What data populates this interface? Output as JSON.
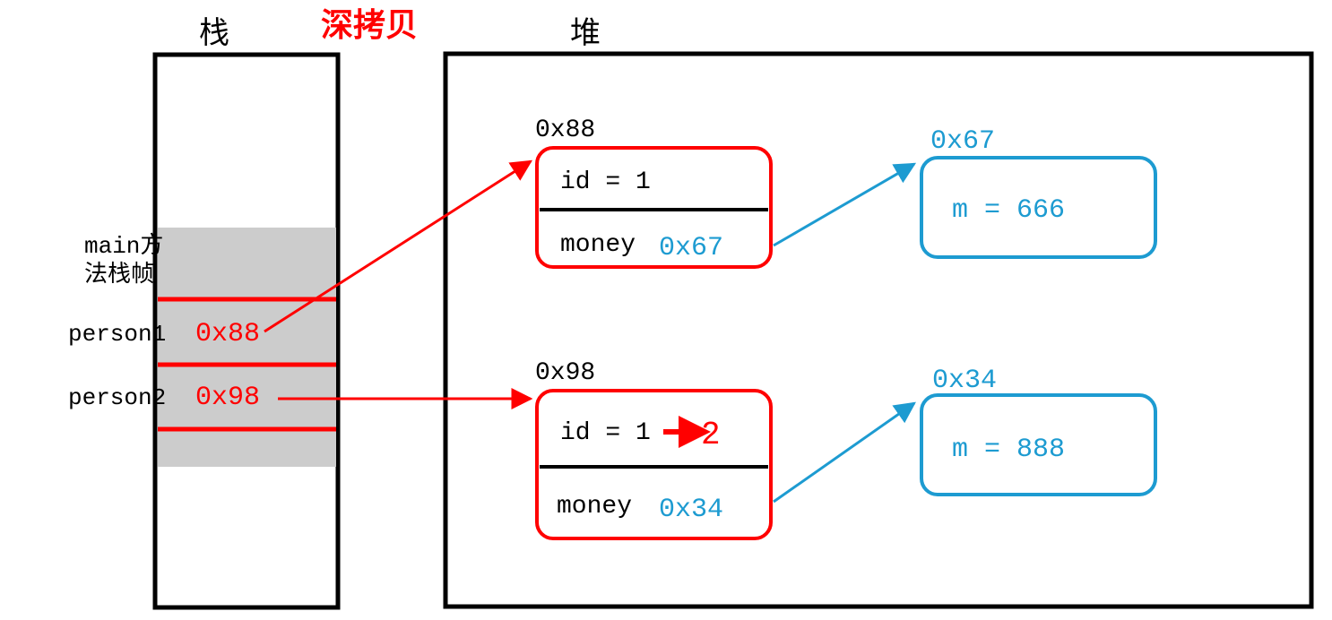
{
  "title": "深拷贝",
  "stack": {
    "label": "栈",
    "frame_label_line1": "main方",
    "frame_label_line2": "法栈帧",
    "vars": {
      "person1": {
        "name": "person1",
        "addr": "0x88"
      },
      "person2": {
        "name": "person2",
        "addr": "0x98"
      }
    }
  },
  "heap": {
    "label": "堆",
    "obj1": {
      "addr": "0x88",
      "id_label": "id = 1",
      "money_label": "money",
      "money_addr": "0x67"
    },
    "obj2": {
      "addr": "0x98",
      "id_label": "id = 1",
      "id_change_to": "2",
      "money_label": "money",
      "money_addr": "0x34"
    },
    "money1": {
      "addr": "0x67",
      "value_label": "m = 666"
    },
    "money2": {
      "addr": "0x34",
      "value_label": "m = 888"
    }
  },
  "colors": {
    "black": "#000000",
    "red": "#ff0000",
    "blue": "#1d9bd1",
    "gray": "#cccccc"
  }
}
